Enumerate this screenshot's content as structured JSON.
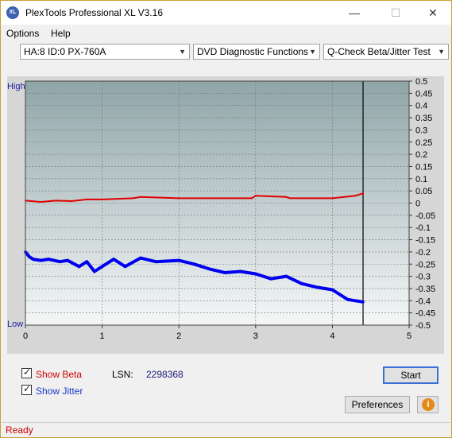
{
  "window": {
    "title": "PlexTools Professional XL V3.16",
    "icon_text": "XL"
  },
  "controls": {
    "minimize": "—",
    "maximize": "☐",
    "close": "✕"
  },
  "menu": {
    "options": "Options",
    "help": "Help"
  },
  "dropdowns": {
    "drive": "HA:8 ID:0  PX-760A",
    "function": "DVD Diagnostic Functions",
    "test": "Q-Check Beta/Jitter Test"
  },
  "chart_data": {
    "type": "line",
    "high_label": "High",
    "low_label": "Low",
    "x_ticks": [
      "0",
      "1",
      "2",
      "3",
      "4",
      "5"
    ],
    "y_ticks": [
      "0.5",
      "0.45",
      "0.4",
      "0.35",
      "0.3",
      "0.25",
      "0.2",
      "0.15",
      "0.1",
      "0.05",
      "0",
      "-0.05",
      "-0.1",
      "-0.15",
      "-0.2",
      "-0.25",
      "-0.3",
      "-0.35",
      "-0.4",
      "-0.45",
      "-0.5"
    ],
    "xlim": [
      0,
      5
    ],
    "ylim": [
      -0.5,
      0.5
    ],
    "marker_x": 4.4,
    "colors": {
      "beta": "#e00000",
      "jitter": "#0000ee",
      "top": "#8fa5a8",
      "bottom": "#f5f7f7"
    },
    "series": [
      {
        "name": "Beta",
        "x": [
          0,
          0.2,
          0.4,
          0.6,
          0.8,
          1.0,
          1.4,
          1.5,
          2.0,
          2.5,
          2.95,
          3.0,
          3.4,
          3.45,
          4.0,
          4.3,
          4.4
        ],
        "y": [
          0.01,
          0.005,
          0.01,
          0.008,
          0.015,
          0.015,
          0.02,
          0.025,
          0.02,
          0.02,
          0.02,
          0.03,
          0.025,
          0.02,
          0.02,
          0.03,
          0.04
        ]
      },
      {
        "name": "Jitter",
        "x": [
          0,
          0.05,
          0.1,
          0.2,
          0.3,
          0.45,
          0.55,
          0.7,
          0.8,
          0.9,
          1.0,
          1.15,
          1.3,
          1.5,
          1.7,
          2.0,
          2.2,
          2.4,
          2.6,
          2.8,
          3.0,
          3.2,
          3.4,
          3.6,
          3.8,
          4.0,
          4.2,
          4.4
        ],
        "y": [
          -0.2,
          -0.22,
          -0.23,
          -0.235,
          -0.23,
          -0.24,
          -0.235,
          -0.26,
          -0.24,
          -0.28,
          -0.26,
          -0.23,
          -0.26,
          -0.225,
          -0.24,
          -0.235,
          -0.25,
          -0.27,
          -0.285,
          -0.28,
          -0.29,
          -0.31,
          -0.3,
          -0.33,
          -0.345,
          -0.355,
          -0.395,
          -0.405
        ]
      }
    ]
  },
  "options": {
    "show_beta": "Show Beta",
    "show_jitter": "Show Jitter",
    "lsn_label": "LSN:",
    "lsn_value": "2298368"
  },
  "buttons": {
    "start": "Start",
    "preferences": "Preferences",
    "info": "i"
  },
  "status": "Ready"
}
